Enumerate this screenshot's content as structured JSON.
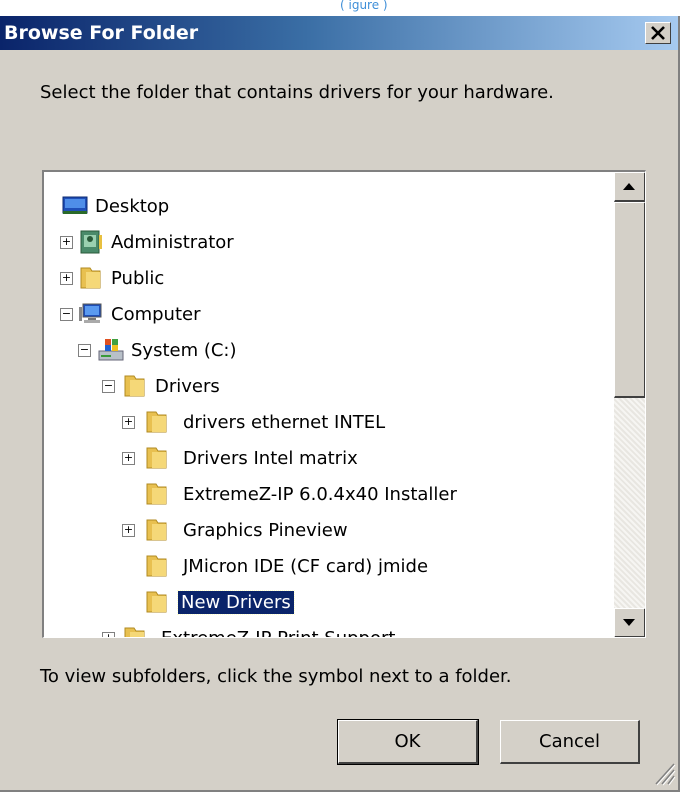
{
  "top_fragment": "( igure )",
  "window": {
    "title": "Browse For Folder",
    "close_label": "×"
  },
  "instruction": "Select the folder that contains drivers for your hardware.",
  "tree": {
    "items": [
      {
        "label": "Desktop"
      },
      {
        "label": "Administrator",
        "expander": "+"
      },
      {
        "label": "Public",
        "expander": "+"
      },
      {
        "label": "Computer",
        "expander": "−"
      },
      {
        "label": "System (C:)",
        "expander": "−"
      },
      {
        "label": "Drivers",
        "expander": "−"
      },
      {
        "label": "drivers ethernet INTEL",
        "expander": "+"
      },
      {
        "label": "Drivers Intel matrix",
        "expander": "+"
      },
      {
        "label": "ExtremeZ-IP 6.0.4x40 Installer"
      },
      {
        "label": "Graphics Pineview",
        "expander": "+"
      },
      {
        "label": "JMicron IDE (CF card) jmide"
      },
      {
        "label": "New Drivers",
        "selected": true
      },
      {
        "label": "ExtremeZ-IP Print Support",
        "expander": "+"
      }
    ]
  },
  "hint": "To view subfolders, click the symbol next to a folder.",
  "buttons": {
    "ok": "OK",
    "cancel": "Cancel"
  }
}
